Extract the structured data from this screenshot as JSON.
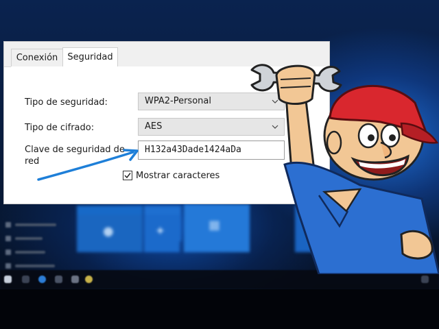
{
  "dialog": {
    "tabs": [
      {
        "label": "Conexión",
        "active": false
      },
      {
        "label": "Seguridad",
        "active": true
      }
    ],
    "security_type": {
      "label": "Tipo de seguridad:",
      "value": "WPA2-Personal"
    },
    "encryption_type": {
      "label": "Tipo de cifrado:",
      "value": "AES"
    },
    "network_key": {
      "label": "Clave de seguridad de red",
      "value": "H132a43Dade1424aDa"
    },
    "show_characters": {
      "label": "Mostrar caracteres",
      "checked": true
    }
  },
  "icons": {
    "dropdown": "chevron-down-icon",
    "check": "checkmark-icon",
    "annotation": "arrow-icon",
    "tile_skype": "skype-icon",
    "tile_twitter": "twitter-icon",
    "tile_store": "store-icon"
  },
  "colors": {
    "accent_arrow": "#1e7fd8",
    "desktop_blue": "#1f6fd6",
    "mascot_cap": "#d9272e",
    "mascot_shirt": "#2c6fd1"
  }
}
